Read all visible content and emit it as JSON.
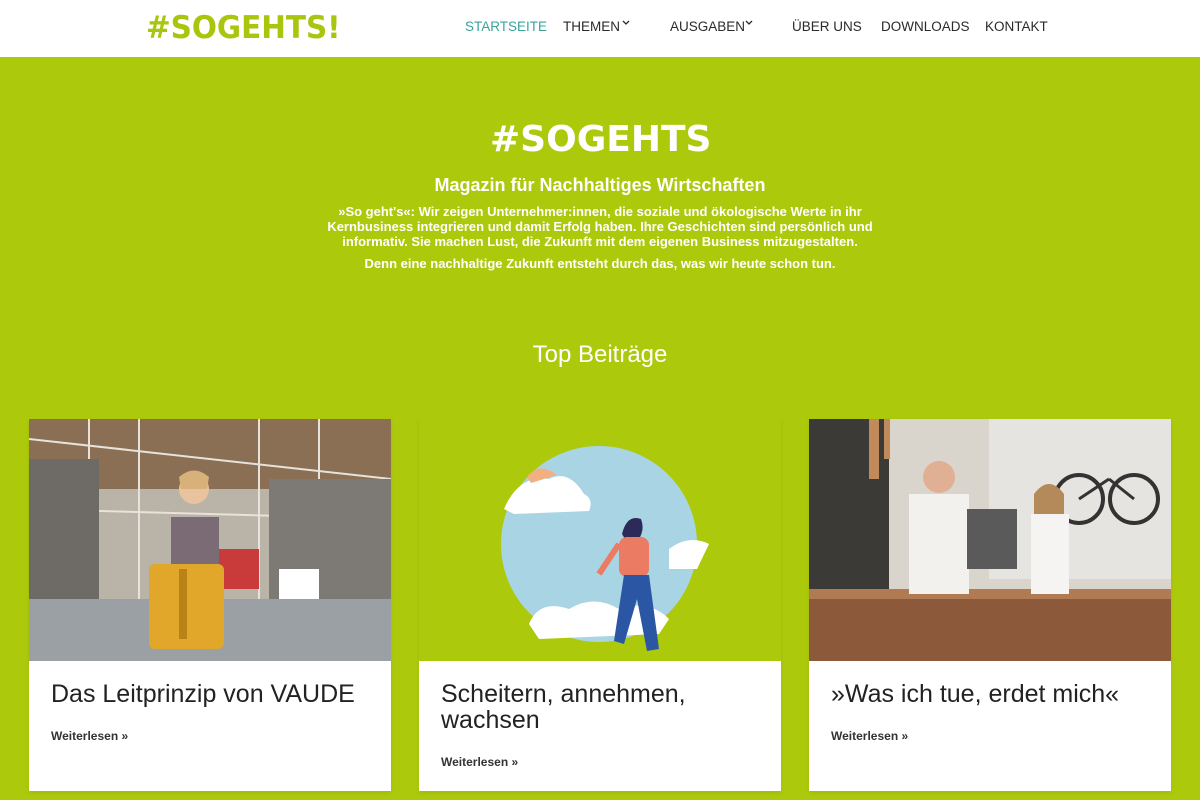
{
  "header": {
    "logo_text": "#SOGEHTS!",
    "nav": [
      {
        "label": "STARTSEITE",
        "active": true
      },
      {
        "label": "THEMEN",
        "has_dropdown": true
      },
      {
        "label": "AUSGABEN",
        "has_dropdown": true
      },
      {
        "label": "ÜBER UNS"
      },
      {
        "label": "DOWNLOADS"
      },
      {
        "label": "KONTAKT"
      }
    ]
  },
  "hero": {
    "logo_text": "#SOGEHTS!",
    "title": "Magazin für Nachhaltiges Wirtschaften",
    "description": "»So geht's«: Wir zeigen Unternehmer:innen, die soziale und ökologische Werte in ihr Kernbusiness integrieren und damit Erfolg haben. Ihre Geschichten sind persönlich und informativ. Sie machen Lust, die Zukunft mit dem eigenen Business mitzugestalten.",
    "tagline": "Denn eine nachhaltige Zukunft entsteht durch das, was wir heute schon tun."
  },
  "top_posts": {
    "title": "Top Beiträge",
    "cards": [
      {
        "title": "Das Leitprinzip von VAUDE",
        "more": "Weiterlesen »",
        "image": "factory-woman-yellow-bag-photo"
      },
      {
        "title": "Scheitern, annehmen, wachsen",
        "more": "Weiterlesen »",
        "image": "woman-walking-clouds-illustration"
      },
      {
        "title": "»Was ich tue, erdet mich«",
        "more": "Weiterlesen »",
        "image": "two-people-cafe-bar-photo"
      }
    ]
  },
  "colors": {
    "brand_green": "#adc90c",
    "nav_active": "#3aa39a",
    "text_dark": "#222222"
  }
}
